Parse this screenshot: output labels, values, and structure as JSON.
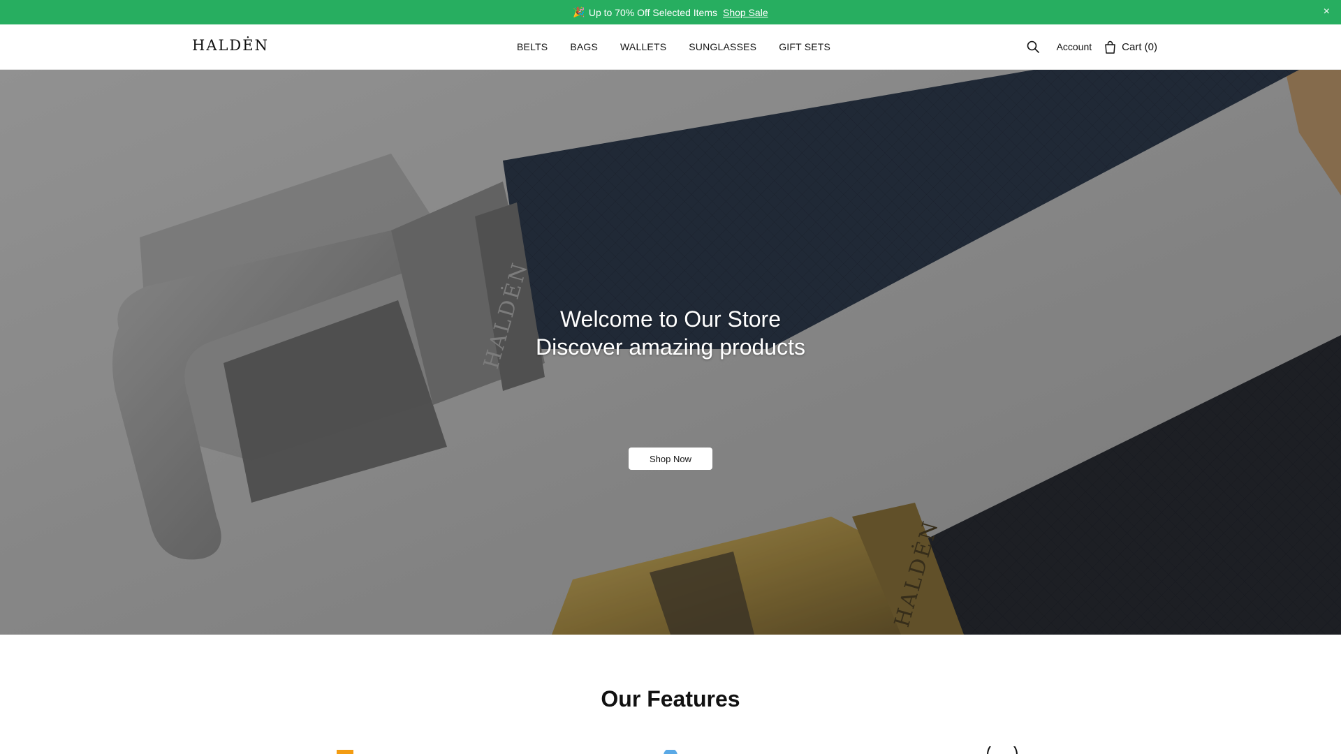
{
  "announcement": {
    "icon": "party-popper-icon",
    "text": "Up to 70% Off Selected Items",
    "link": "Shop Sale",
    "close": "×",
    "background": "#27ae60"
  },
  "header": {
    "logo": "HALDĖN",
    "nav": [
      "BELTS",
      "BAGS",
      "WALLETS",
      "SUNGLASSES",
      "GIFT SETS"
    ],
    "account": "Account",
    "cart": "Cart (0)"
  },
  "hero": {
    "line1": "Welcome to Our Store",
    "line2": "Discover amazing products",
    "button": "Shop Now"
  },
  "features": {
    "title": "Our Features",
    "icons": [
      "badge-icon",
      "globe-icon",
      "circle-icon"
    ]
  }
}
